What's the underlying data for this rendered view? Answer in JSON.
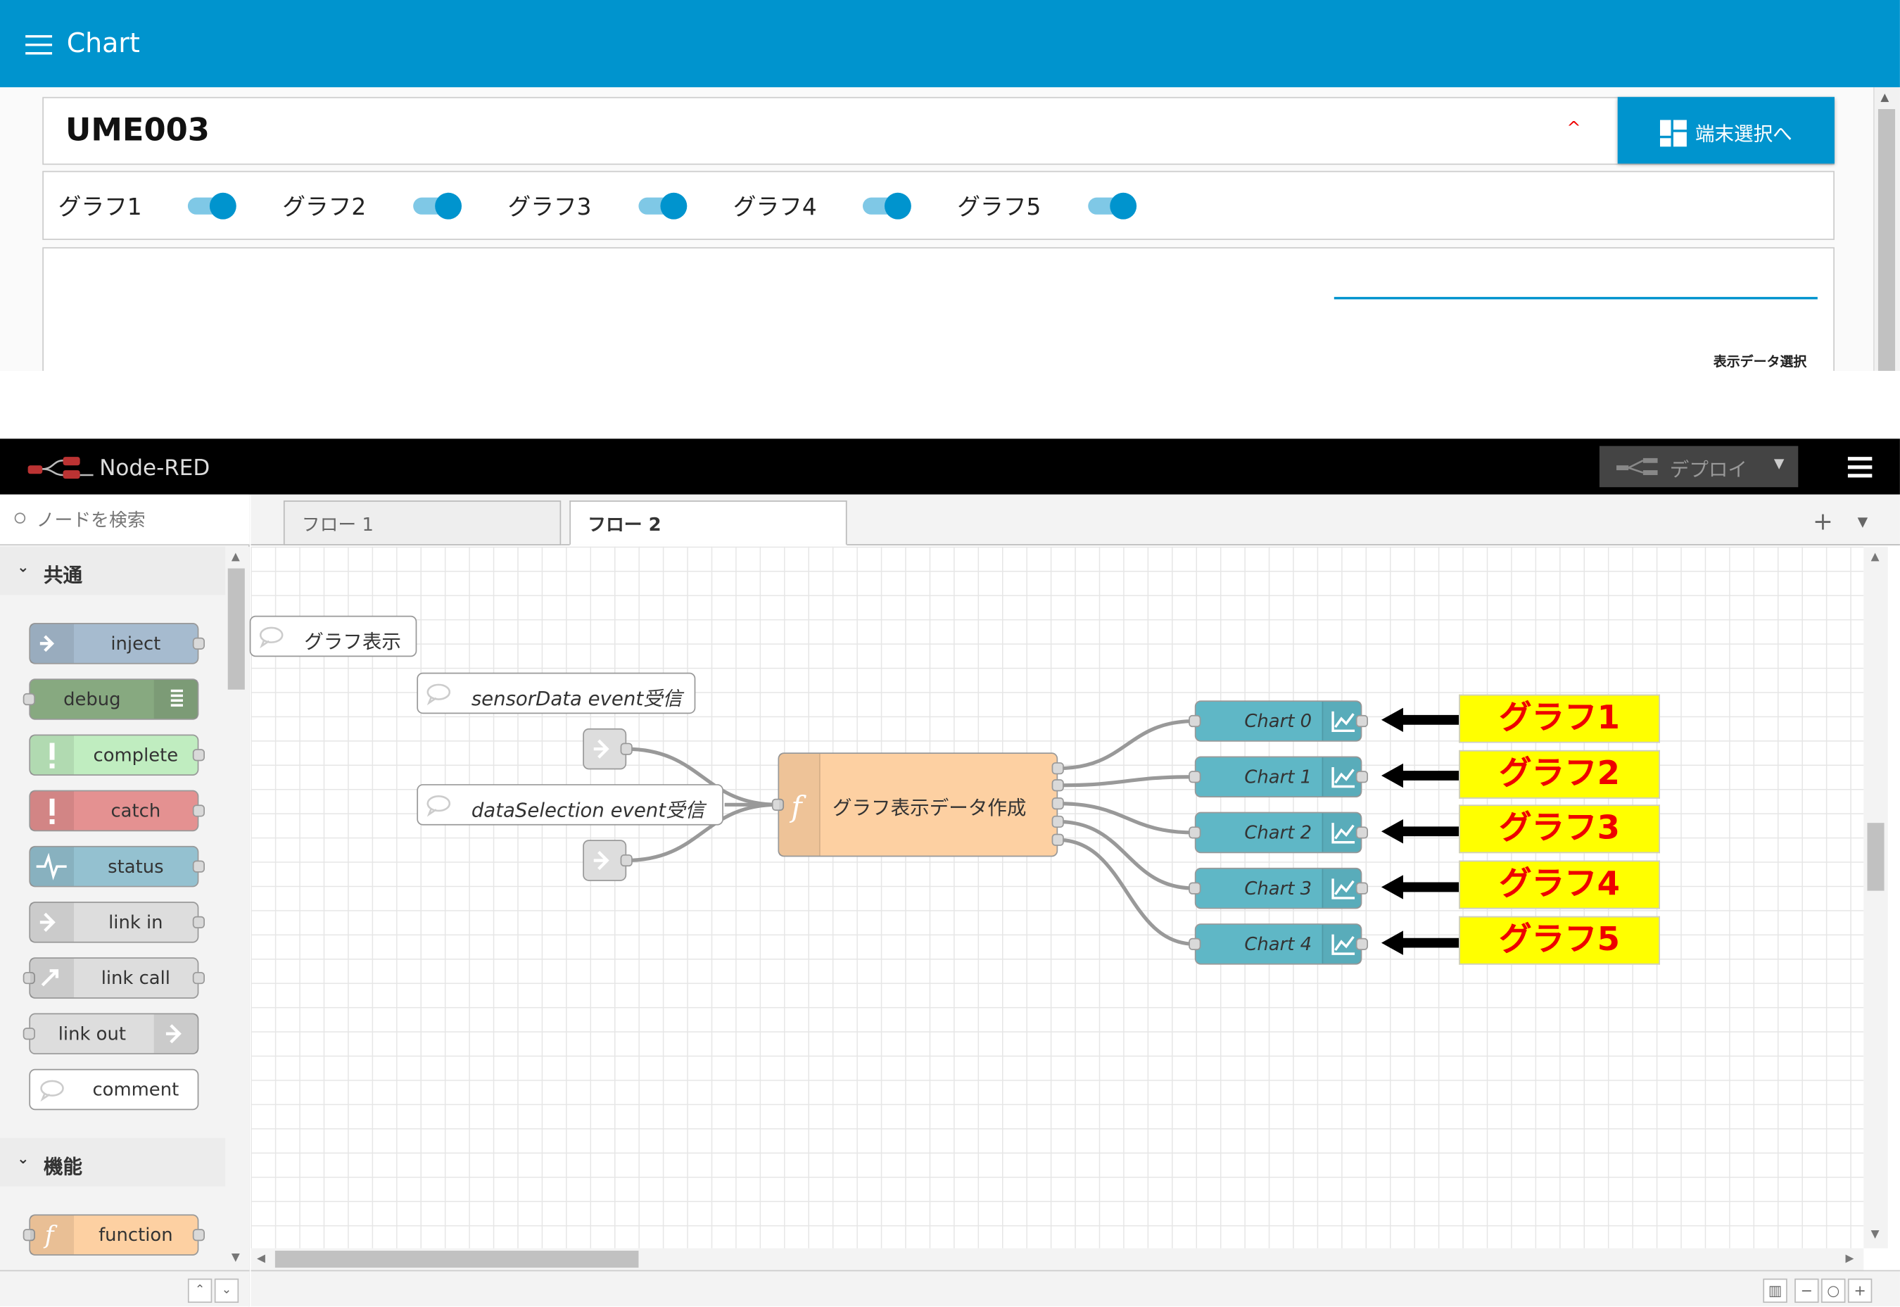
{
  "dashboard": {
    "title": "Chart",
    "device": "UME003",
    "select_button": "端末選択へ",
    "toggles": [
      "グラフ1",
      "グラフ2",
      "グラフ3",
      "グラフ4",
      "グラフ5"
    ],
    "data_select_label": "表示データ選択"
  },
  "nodered": {
    "app_name": "Node-RED",
    "deploy_label": "デプロイ",
    "search_placeholder": "ノードを検索",
    "categories": [
      "共通",
      "機能"
    ],
    "palette_nodes": [
      "inject",
      "debug",
      "complete",
      "catch",
      "status",
      "link in",
      "link call",
      "link out",
      "comment",
      "function"
    ],
    "tabs": [
      "フロー 1",
      "フロー 2"
    ],
    "flow": {
      "comment_top": "グラフ表示",
      "comment_sensor": "sensorData event受信",
      "comment_selection": "dataSelection event受信",
      "function_node": "グラフ表示データ作成",
      "charts": [
        "Chart 0",
        "Chart 1",
        "Chart 2",
        "Chart 3",
        "Chart 4"
      ],
      "annotations": [
        "グラフ1",
        "グラフ2",
        "グラフ3",
        "グラフ4",
        "グラフ5"
      ]
    }
  },
  "colors": {
    "dashboard_blue": "#0094ce",
    "chart_node": "#5fb7c6",
    "function_node": "#fdd0a2",
    "annotation_bg": "#ffff00",
    "annotation_text": "#ee0000"
  }
}
